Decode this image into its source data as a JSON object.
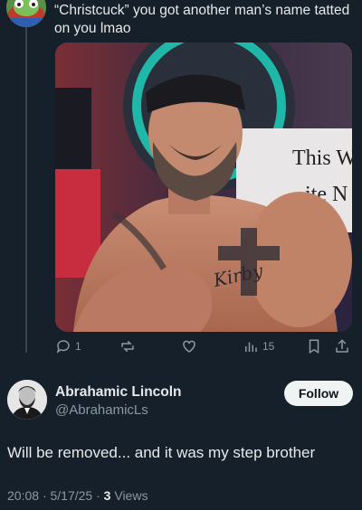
{
  "reply": {
    "text": "“Christcuck” you got another man’s name tatted on you lmao"
  },
  "media": {
    "sign_text_1": "This W",
    "sign_text_2": "ite N",
    "tattoo_text": "Kirby"
  },
  "actions": {
    "replies": "1",
    "likes": "",
    "views": "15"
  },
  "author": {
    "name": "Abrahamic Lincoln",
    "handle": "@AbrahamicLs",
    "follow_label": "Follow"
  },
  "post": {
    "text": "Will be removed... and it was my step brother",
    "time": "20:08",
    "date": "5/17/25",
    "views_count": "3",
    "views_label": "Views",
    "separator": "·"
  },
  "colors": {
    "background": "#15202b",
    "text": "#e7e9ea",
    "muted": "#8b98a5",
    "thread_line": "#38444d"
  }
}
